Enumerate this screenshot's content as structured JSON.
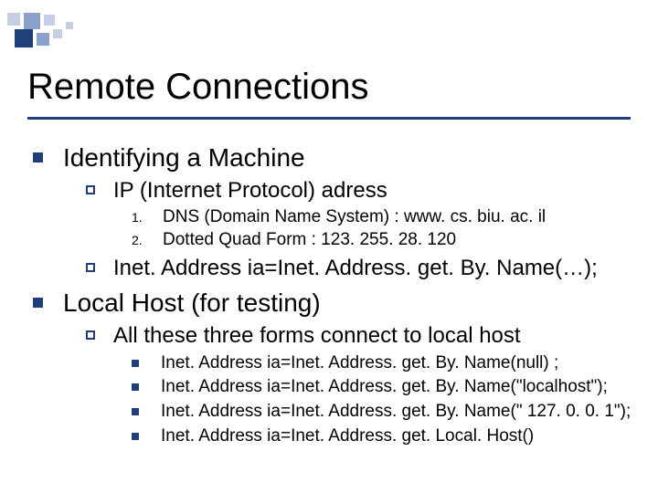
{
  "title": "Remote Connections",
  "section1": {
    "heading": "Identifying a Machine",
    "sub1": {
      "label": "IP (Internet Protocol) adress",
      "items": [
        "DNS (Domain Name System) : www. cs. biu. ac. il",
        "Dotted Quad Form : 123. 255. 28. 120"
      ]
    },
    "sub2": {
      "label": "Inet. Address ia=Inet. Address. get. By. Name(…);"
    }
  },
  "section2": {
    "heading": "Local Host (for testing)",
    "sub1": {
      "label": "All these three forms connect to local host",
      "items": [
        "Inet. Address ia=Inet. Address. get. By. Name(null) ;",
        "Inet. Address ia=Inet. Address. get. By. Name(\"localhost\");",
        "Inet. Address ia=Inet. Address. get. By. Name(\" 127. 0. 0. 1\");",
        "Inet. Address ia=Inet. Address. get. Local. Host()"
      ]
    }
  },
  "numbers": [
    "1.",
    "2."
  ],
  "deco_colors": {
    "dark": "#21407b",
    "mid": "#8aa0c8",
    "light": "#c5d0e6"
  }
}
